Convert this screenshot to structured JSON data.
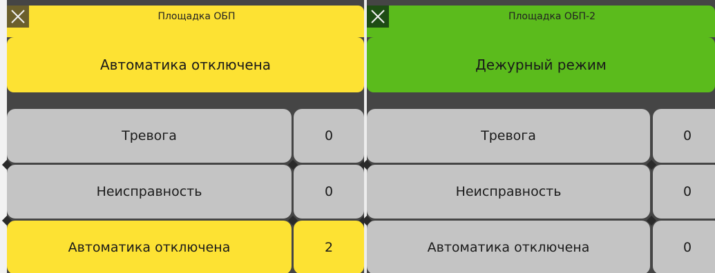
{
  "panels": [
    {
      "title": "Площадка ОБП",
      "status": "Автоматика отключена",
      "theme": "yellow",
      "rows": [
        {
          "label": "Тревога",
          "count": "0",
          "highlighted": false
        },
        {
          "label": "Неисправность",
          "count": "0",
          "highlighted": false
        },
        {
          "label": "Автоматика отключена",
          "count": "2",
          "highlighted": true
        }
      ]
    },
    {
      "title": "Площадка ОБП-2",
      "status": "Дежурный режим",
      "theme": "green",
      "rows": [
        {
          "label": "Тревога",
          "count": "0",
          "highlighted": false
        },
        {
          "label": "Неисправность",
          "count": "0",
          "highlighted": false
        },
        {
          "label": "Автоматика отключена",
          "count": "0",
          "highlighted": false
        }
      ]
    }
  ],
  "colors": {
    "yellow": "#fde233",
    "green": "#5bbb1c",
    "grey": "#c4c4c4",
    "background": "#454545"
  },
  "icons": {
    "close": "close-icon"
  }
}
